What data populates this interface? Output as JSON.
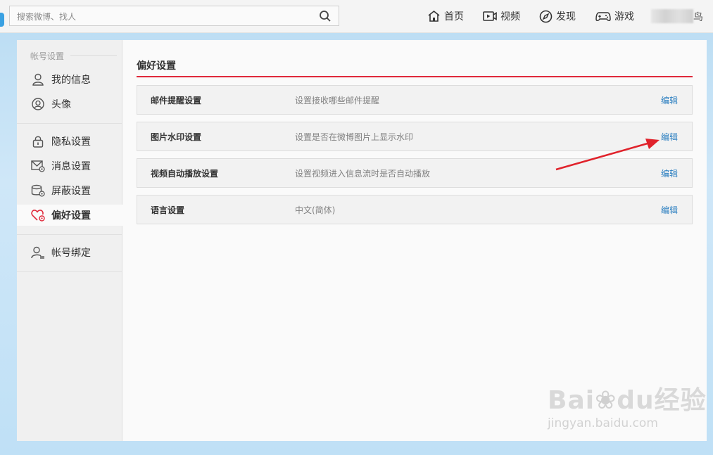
{
  "search": {
    "placeholder": "搜索微博、找人"
  },
  "nav": {
    "home": "首页",
    "video": "视频",
    "discover": "发现",
    "game": "游戏",
    "user_tail": "鸟"
  },
  "sidebar": {
    "section_title": "帐号设置",
    "items": [
      {
        "label": "我的信息",
        "icon": "user-icon"
      },
      {
        "label": "头像",
        "icon": "avatar-icon"
      },
      {
        "label": "隐私设置",
        "icon": "lock-icon"
      },
      {
        "label": "消息设置",
        "icon": "message-settings-icon"
      },
      {
        "label": "屏蔽设置",
        "icon": "block-settings-icon"
      },
      {
        "label": "偏好设置",
        "icon": "heart-settings-icon",
        "active": true
      },
      {
        "label": "帐号绑定",
        "icon": "account-bind-icon"
      }
    ]
  },
  "main": {
    "title": "偏好设置",
    "rows": [
      {
        "name": "邮件提醒设置",
        "desc": "设置接收哪些邮件提醒",
        "action": "编辑"
      },
      {
        "name": "图片水印设置",
        "desc": "设置是否在微博图片上显示水印",
        "action": "编辑"
      },
      {
        "name": "视频自动播放设置",
        "desc": "设置视频进入信息流时是否自动播放",
        "action": "编辑"
      },
      {
        "name": "语言设置",
        "desc": "中文(简体)",
        "action": "编辑"
      }
    ]
  },
  "watermark": {
    "brand": "Bai",
    "brand2": "du",
    "cn": "经验",
    "url": "jingyan.baidu.com"
  },
  "colors": {
    "accent_red": "#e0283a",
    "link_blue": "#2a7ec0",
    "annotation_arrow": "#e0222b"
  }
}
